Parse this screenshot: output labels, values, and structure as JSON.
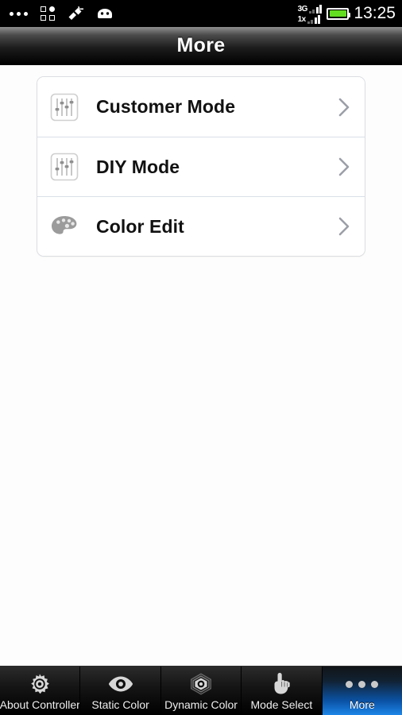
{
  "statusbar": {
    "left_icons": [
      {
        "name": "more-dots-icon",
        "label": "•••"
      },
      {
        "name": "app-grid-icon",
        "label": "grid"
      },
      {
        "name": "usb-debug-icon",
        "label": "usb"
      },
      {
        "name": "android-robot-icon",
        "label": "android"
      }
    ],
    "signal": {
      "network_primary": "3G",
      "network_secondary": "1x"
    },
    "battery": {
      "name": "battery-icon",
      "color": "#63dd20"
    },
    "clock": "13:25"
  },
  "header": {
    "title": "More"
  },
  "main": {
    "rows": [
      {
        "icon": "equalizer-sliders-icon",
        "label": "Customer Mode",
        "chevron": "chevron-right-icon"
      },
      {
        "icon": "equalizer-sliders-icon",
        "label": "DIY Mode",
        "chevron": "chevron-right-icon"
      },
      {
        "icon": "color-palette-icon",
        "label": "Color Edit",
        "chevron": "chevron-right-icon"
      }
    ]
  },
  "tabbar": {
    "active_index": 4,
    "active_color": "#1d86e8",
    "tabs": [
      {
        "label": "About Controller",
        "icon": "gear-icon"
      },
      {
        "label": "Static Color",
        "icon": "eye-icon"
      },
      {
        "label": "Dynamic Color",
        "icon": "layered-eye-icon"
      },
      {
        "label": "Mode Select",
        "icon": "pointing-hand-icon"
      },
      {
        "label": "More",
        "icon": "three-dots-icon"
      }
    ]
  }
}
